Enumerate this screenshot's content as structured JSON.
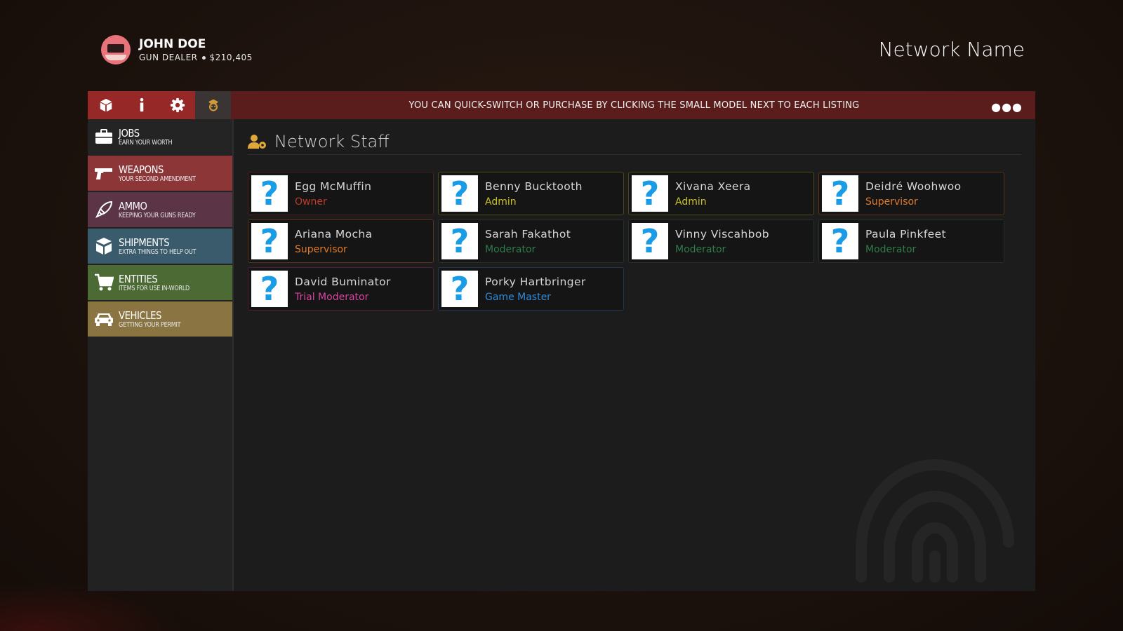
{
  "profile": {
    "name": "JOHN DOE",
    "job": "GUN DEALER",
    "money": "$210,405"
  },
  "network_name": "Network Name",
  "banner": "YOU CAN QUICK-SWITCH OR PURCHASE BY CLICKING THE SMALL MODEL NEXT TO EACH LISTING",
  "toolbar_icons": [
    "box-icon",
    "info-icon",
    "gear-icon",
    "staff-badge-icon"
  ],
  "categories": [
    {
      "title": "JOBS",
      "subtitle": "EARN YOUR WORTH",
      "color": "#242424",
      "icon": "briefcase-icon"
    },
    {
      "title": "WEAPONS",
      "subtitle": "YOUR SECOND AMENDMENT",
      "color": "#8c3637",
      "icon": "pistol-icon"
    },
    {
      "title": "AMMO",
      "subtitle": "KEEPING YOUR GUNS READY",
      "color": "#5b3446",
      "icon": "bullet-icon"
    },
    {
      "title": "SHIPMENTS",
      "subtitle": "EXTRA THINGS TO HELP OUT",
      "color": "#3a5b6b",
      "icon": "boxes-icon"
    },
    {
      "title": "ENTITIES",
      "subtitle": "ITEMS FOR USE IN-WORLD",
      "color": "#4c6a33",
      "icon": "cart-icon"
    },
    {
      "title": "VEHICLES",
      "subtitle": "GETTING YOUR PERMIT",
      "color": "#8a7442",
      "icon": "car-icon"
    }
  ],
  "section": {
    "title": "Network Staff",
    "icon": "user-gear-icon",
    "accent": "#e0a73a"
  },
  "staff": [
    {
      "name": "Egg McMuffin",
      "role": "Owner",
      "color": "#c0392b",
      "border": "#4a2020"
    },
    {
      "name": "Benny Bucktooth",
      "role": "Admin",
      "color": "#c9c227",
      "border": "#4b4718"
    },
    {
      "name": "Xivana Xeera",
      "role": "Admin",
      "color": "#c9c227",
      "border": "#4b4718"
    },
    {
      "name": "Deidré Woohwoo",
      "role": "Supervisor",
      "color": "#e07b2a",
      "border": "#5a3119"
    },
    {
      "name": "Ariana Mocha",
      "role": "Supervisor",
      "color": "#e07b2a",
      "border": "#5a3119"
    },
    {
      "name": "Sarah Fakathot",
      "role": "Moderator",
      "color": "#2f7a4c",
      "border": "#263029"
    },
    {
      "name": "Vinny Viscahbob",
      "role": "Moderator",
      "color": "#2f7a4c",
      "border": "#263029"
    },
    {
      "name": "Paula Pinkfeet",
      "role": "Moderator",
      "color": "#2f7a4c",
      "border": "#263029"
    },
    {
      "name": "David Buminator",
      "role": "Trial Moderator",
      "color": "#d6469c",
      "border": "#4d2038"
    },
    {
      "name": "Porky Hartbringer",
      "role": "Game Master",
      "color": "#2f8bd8",
      "border": "#1d3754"
    }
  ],
  "placeholder_glyph": "?"
}
